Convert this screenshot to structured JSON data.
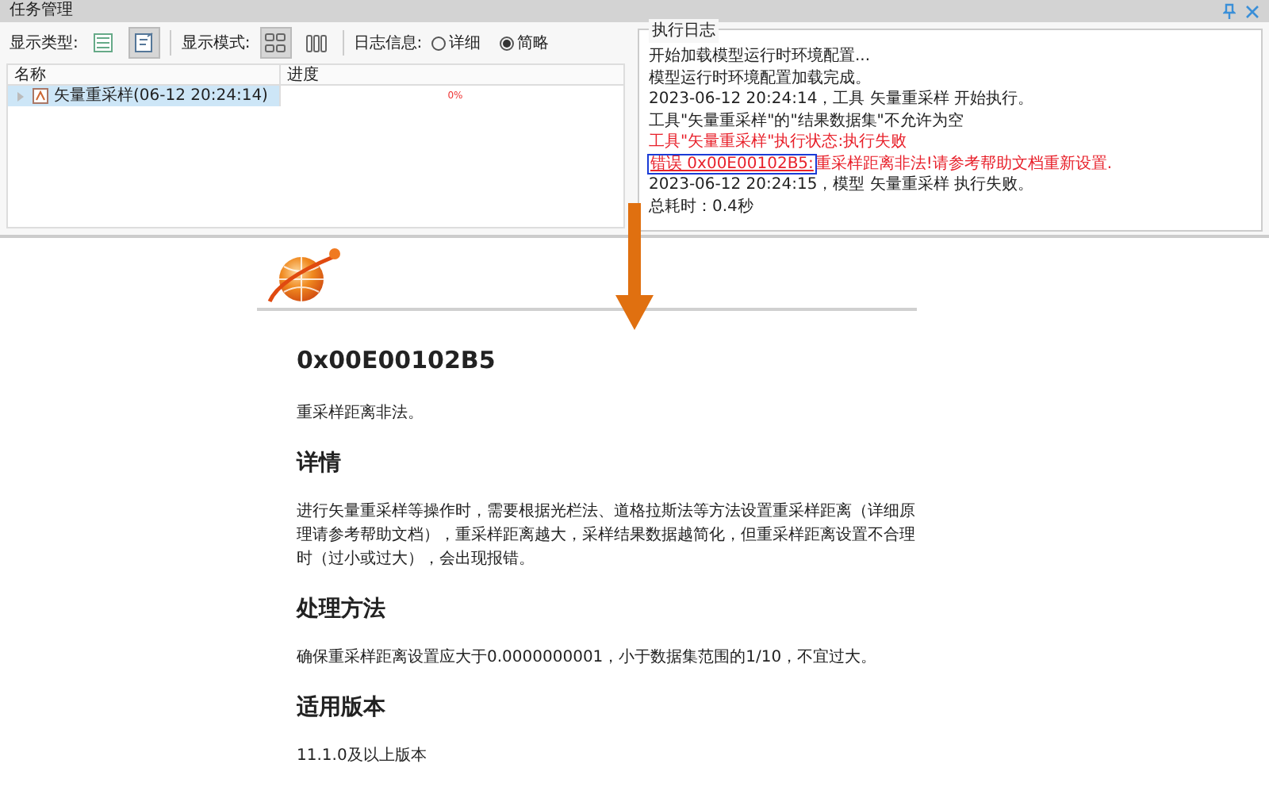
{
  "window": {
    "title": "任务管理"
  },
  "toolbar": {
    "display_type_label": "显示类型:",
    "display_type_buttons": [
      {
        "selected": false
      },
      {
        "selected": true
      }
    ],
    "display_mode_label": "显示模式:",
    "display_mode_buttons": [
      {
        "selected": true
      },
      {
        "selected": false
      }
    ],
    "log_info_label": "日志信息:",
    "log_options": [
      {
        "label": "详细",
        "selected": false
      },
      {
        "label": "简略",
        "selected": true
      }
    ]
  },
  "task_table": {
    "columns": [
      "名称",
      "进度"
    ],
    "rows": [
      {
        "name": "矢量重采样(06-12 20:24:14)",
        "progress": "0%",
        "selected": true,
        "expanded": false
      }
    ]
  },
  "log_panel": {
    "title": "执行日志",
    "lines": [
      {
        "kind": "info",
        "text": "开始加载模型运行时环境配置..."
      },
      {
        "kind": "info",
        "text": "模型运行时环境配置加载完成。"
      },
      {
        "kind": "info",
        "text": "2023-06-12 20:24:14，工具 矢量重采样 开始执行。"
      },
      {
        "kind": "info",
        "text": "工具\"矢量重采样\"的\"结果数据集\"不允许为空"
      },
      {
        "kind": "error",
        "text": "工具\"矢量重采样\"执行状态:执行失败"
      },
      {
        "kind": "error_link",
        "link": "错误 0x00E00102B5:",
        "text": "重采样距离非法!请参考帮助文档重新设置."
      },
      {
        "kind": "info",
        "text": "2023-06-12 20:24:15，模型 矢量重采样 执行失败。"
      },
      {
        "kind": "info",
        "text": "总耗时：0.4秒"
      }
    ]
  },
  "help_page": {
    "code": "0x00E00102B5",
    "summary": "重采样距离非法。",
    "sections": [
      {
        "heading": "详情",
        "text": "进行矢量重采样等操作时，需要根据光栏法、道格拉斯法等方法设置重采样距离（详细原理请参考帮助文档），重采样距离越大，采样结果数据越简化，但重采样距离设置不合理时（过小或过大），会出现报错。"
      },
      {
        "heading": "处理方法",
        "text": "确保重采样距离设置应大于0.0000000001，小于数据集范围的1/10，不宜过大。"
      },
      {
        "heading": "适用版本",
        "text": "11.1.0及以上版本"
      }
    ]
  }
}
